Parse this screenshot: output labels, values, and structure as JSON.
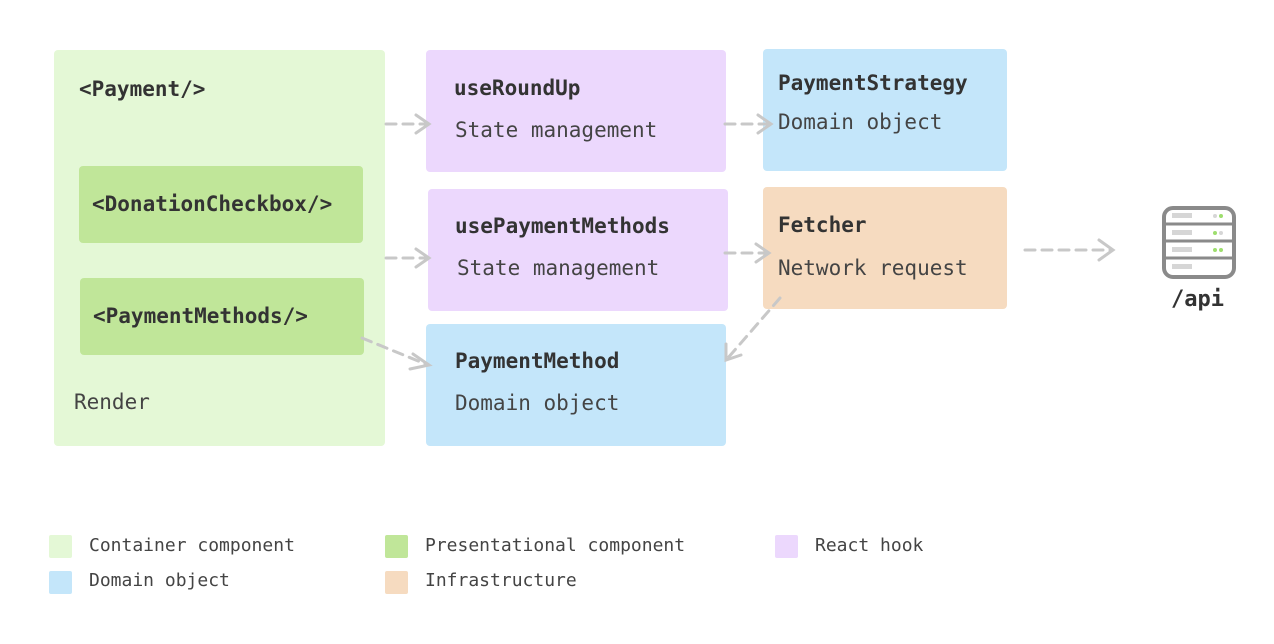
{
  "colors": {
    "container": "#e4f8d6",
    "presentational": "#c0e699",
    "hook": "#ecd8fd",
    "domain": "#c4e6fa",
    "infrastructure": "#f6dbc0",
    "arrow": "#c8c8c8"
  },
  "payment": {
    "title": "<Payment/>",
    "footer": "Render"
  },
  "donation_checkbox": {
    "title": "<DonationCheckbox/>"
  },
  "payment_methods_comp": {
    "title": "<PaymentMethods/>"
  },
  "use_round_up": {
    "title": "useRoundUp",
    "subtitle": "State management"
  },
  "use_payment_methods": {
    "title": "usePaymentMethods",
    "subtitle": "State management"
  },
  "payment_method": {
    "title": "PaymentMethod",
    "subtitle": "Domain object"
  },
  "payment_strategy": {
    "title": "PaymentStrategy",
    "subtitle": "Domain object"
  },
  "fetcher": {
    "title": "Fetcher",
    "subtitle": "Network request"
  },
  "api": {
    "label": "/api",
    "icon": "server-icon"
  },
  "legend": [
    {
      "label": "Container component",
      "color": "#e4f8d6"
    },
    {
      "label": "Presentational component",
      "color": "#c0e699"
    },
    {
      "label": "React hook",
      "color": "#ecd8fd"
    },
    {
      "label": "Domain object",
      "color": "#c4e6fa"
    },
    {
      "label": "Infrastructure",
      "color": "#f6dbc0"
    }
  ]
}
